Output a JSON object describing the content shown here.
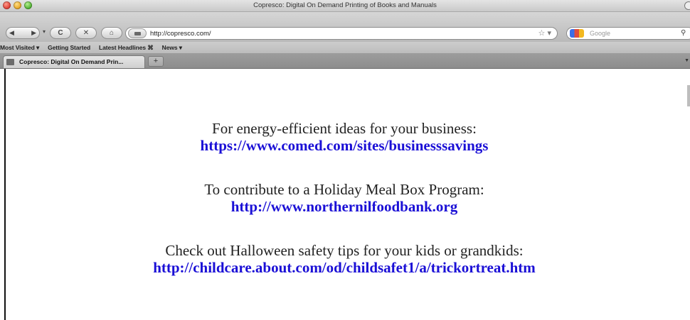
{
  "window": {
    "title": "Copresco: Digital On Demand Printing of Books and Manuals"
  },
  "toolbar": {
    "back_glyph": "◀",
    "forward_glyph": "▶",
    "reload_glyph": "C",
    "stop_glyph": "✕",
    "home_glyph": "⌂",
    "url": "http://copresco.com/",
    "star_glyph": "☆ ▾",
    "search_placeholder": "Google",
    "search_glyph": "⚲"
  },
  "bookmarks": [
    "Most Visited ▾",
    "Getting Started",
    "Latest Headlines ⌘",
    "News ▾"
  ],
  "tabs": [
    {
      "label": "Copresco: Digital On Demand Prin..."
    }
  ],
  "newtab_glyph": "+",
  "content": {
    "items": [
      {
        "text": "For energy-efficient ideas for your business:",
        "link": "https://www.comed.com/sites/businesssavings"
      },
      {
        "text": "To contribute to a Holiday Meal Box Program:",
        "link": "http://www.northernilfoodbank.org"
      },
      {
        "text": "Check out Halloween safety tips for your kids or grandkids:",
        "link": "http://childcare.about.com/od/childsafet1/a/trickortreat.htm"
      }
    ]
  },
  "colors": {
    "link": "#1a0fd6",
    "text": "#222222"
  }
}
